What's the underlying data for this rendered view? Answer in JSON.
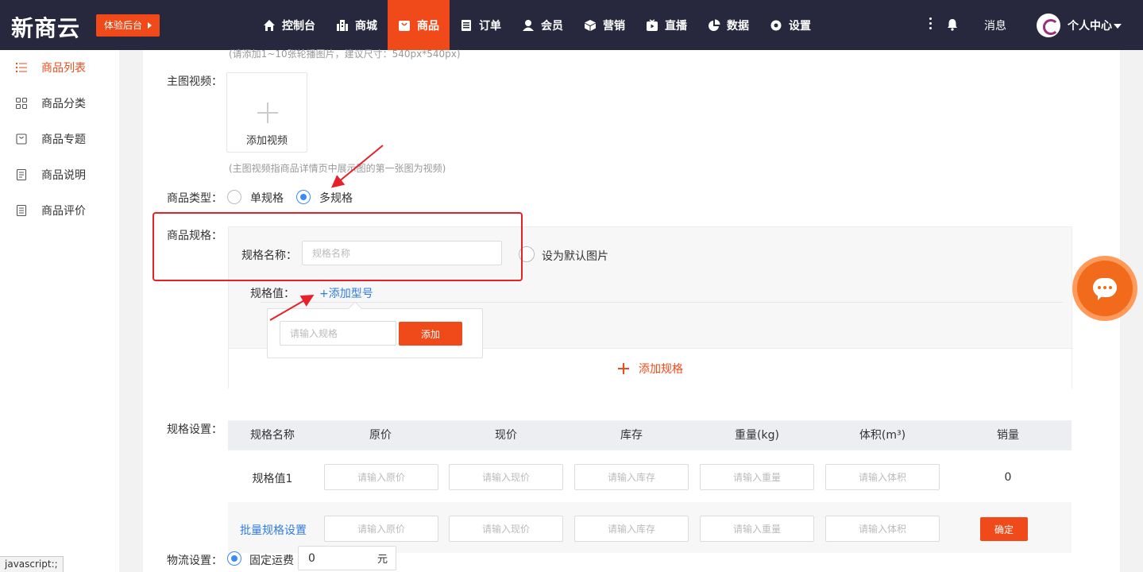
{
  "header": {
    "logo": "新商云",
    "trial_button": "体验后台",
    "nav": [
      {
        "label": "控制台",
        "icon": "home-icon"
      },
      {
        "label": "商城",
        "icon": "building-icon"
      },
      {
        "label": "商品",
        "icon": "bag-icon",
        "active": true
      },
      {
        "label": "订单",
        "icon": "order-icon"
      },
      {
        "label": "会员",
        "icon": "user-icon"
      },
      {
        "label": "营销",
        "icon": "cube-icon"
      },
      {
        "label": "直播",
        "icon": "live-icon"
      },
      {
        "label": "数据",
        "icon": "pie-icon"
      },
      {
        "label": "设置",
        "icon": "gear-icon"
      }
    ],
    "messages": "消息",
    "user_center": "个人中心"
  },
  "sidebar": {
    "items": [
      {
        "label": "商品列表",
        "icon": "list-icon",
        "active": true
      },
      {
        "label": "商品分类",
        "icon": "grid-icon"
      },
      {
        "label": "商品专题",
        "icon": "bag-outline-icon"
      },
      {
        "label": "商品说明",
        "icon": "doc-icon"
      },
      {
        "label": "商品评价",
        "icon": "review-icon"
      }
    ]
  },
  "form": {
    "carousel_hint": "(请添加1~10张轮播图片，建议尺寸：540px*540px)",
    "main_video_label": "主图视频：",
    "add_video": "添加视频",
    "video_hint": "(主图视频指商品详情页中展示图的第一张图为视频)",
    "product_type_label": "商品类型：",
    "type_single": "单规格",
    "type_multi": "多规格",
    "spec_label": "商品规格：",
    "spec_name_label": "规格名称：",
    "spec_name_placeholder": "规格名称",
    "set_default_image": "设为默认图片",
    "spec_value_label": "规格值：",
    "add_model": "+添加型号",
    "spec_input_placeholder": "请输入规格",
    "add_button": "添加",
    "add_spec": "添加规格",
    "spec_settings_label": "规格设置：",
    "shipping_label": "物流设置：",
    "fixed_freight": "固定运费",
    "freight_value": "0",
    "freight_unit": "元"
  },
  "table": {
    "columns": [
      "规格名称",
      "原价",
      "现价",
      "库存",
      "重量(kg)",
      "体积(m³)",
      "销量"
    ],
    "row": {
      "name": "规格值1",
      "placeholders": [
        "请输入原价",
        "请输入现价",
        "请输入库存",
        "请输入重量",
        "请输入体积"
      ],
      "sales": "0"
    },
    "batch": {
      "label": "批量规格设置",
      "placeholders": [
        "请输入原价",
        "请输入现价",
        "请输入库存",
        "请输入重量",
        "请输入体积"
      ],
      "confirm": "确定"
    }
  },
  "status_bar": "javascript:;",
  "colors": {
    "accent": "#f04a1a",
    "nav_bg": "#27283d",
    "link": "#2f7de1",
    "annotation": "#e8202a"
  }
}
